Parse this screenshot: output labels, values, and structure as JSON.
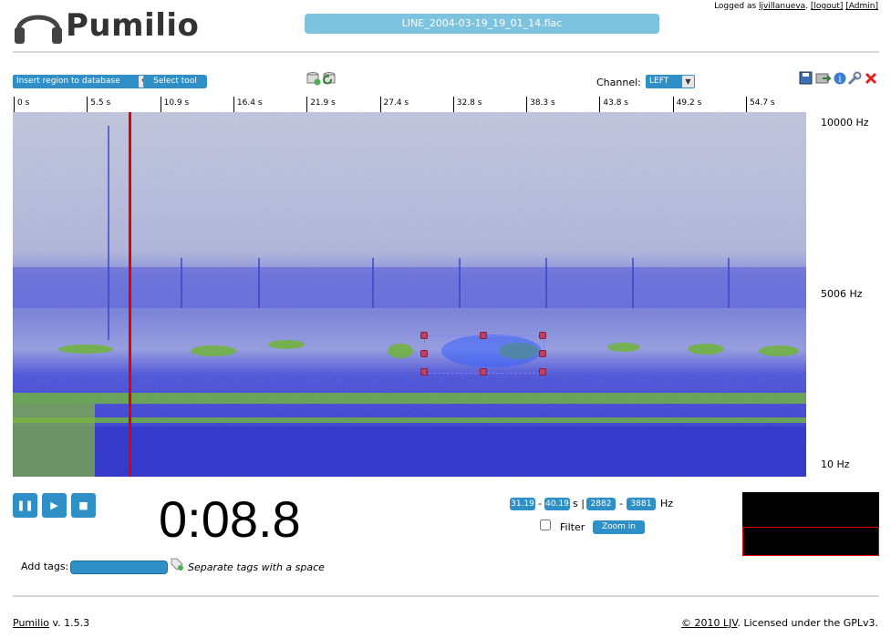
{
  "app": {
    "name": "Pumilio",
    "file_title": "LINE_2004-03-19_19_01_14.flac"
  },
  "login": {
    "prefix": "Logged as",
    "user": "ljvillanueva",
    "logout": "[logout]",
    "admin": "[Admin]"
  },
  "toolbar": {
    "insert_select": "Insert region to database",
    "select_tool": "Select tool",
    "channel_label": "Channel:",
    "channel_value": "LEFT"
  },
  "icons": {
    "left_tools": [
      "database-add-icon",
      "database-refresh-icon"
    ],
    "right_tools": [
      "save-icon",
      "export-icon",
      "info-icon",
      "wrench-icon",
      "close-icon"
    ]
  },
  "ruler": {
    "ticks": [
      "0 s",
      "5.5 s",
      "10.9 s",
      "16.4 s",
      "21.9 s",
      "27.4 s",
      "32.8 s",
      "38.3 s",
      "43.8 s",
      "49.2 s",
      "54.7 s"
    ]
  },
  "spectrogram": {
    "freq_top": "10000 Hz",
    "freq_mid": "5006 Hz",
    "freq_bottom": "10 Hz",
    "cursor_time_s": 8.8,
    "duration_s": 60.2,
    "selection": {
      "t_start": 31.19,
      "t_end": 40.19,
      "f_low": 2882,
      "f_high": 3881
    }
  },
  "player": {
    "time": "0:08.8"
  },
  "selection_fields": {
    "t_start": "31.19",
    "t_end": "40.19",
    "t_unit": "s |",
    "f_low": "2882",
    "f_high": "3881",
    "f_unit": "Hz",
    "dash": "-",
    "filter_label": "Filter",
    "zoom_in": "Zoom in"
  },
  "tags": {
    "label": "Add tags:",
    "hint": "Separate tags with a space"
  },
  "footer": {
    "app_link": "Pumilio",
    "version": "v. 1.5.3",
    "copyright_link": "© 2010 LJV",
    "license": ". Licensed under the GPLv3."
  },
  "colors": {
    "accent": "#2f8fc7",
    "title_bar": "#7cc3e0",
    "cursor": "#e00000",
    "spec_bg": "#c8cdd8",
    "spec_blue": "#3a3ed0",
    "spec_green": "#6fb43a"
  }
}
